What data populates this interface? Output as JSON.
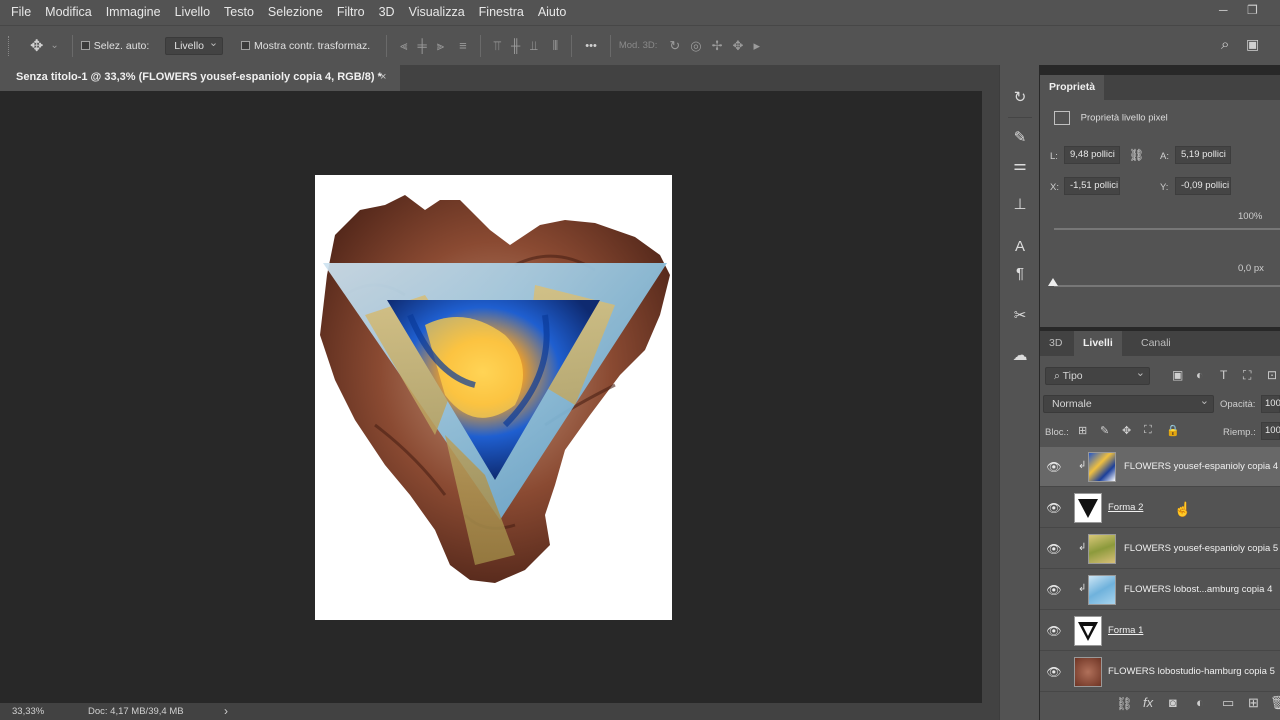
{
  "menu": [
    "File",
    "Modifica",
    "Immagine",
    "Livello",
    "Testo",
    "Selezione",
    "Filtro",
    "3D",
    "Visualizza",
    "Finestra",
    "Aiuto"
  ],
  "window_controls": {
    "minimize": "─",
    "restore": "❐"
  },
  "options": {
    "auto_select_label": "Selez. auto:",
    "auto_select_value": "Livello",
    "transform_label": "Mostra contr. trasformaz.",
    "mode3d_label": "Mod. 3D:",
    "more": "•••"
  },
  "document": {
    "tab_title": "Senza titolo-1 @ 33,3% (FLOWERS yousef-espanioly copia 4, RGB/8) *",
    "close": "×"
  },
  "status": {
    "zoom": "33,33%",
    "doc": "Doc: 4,17 MB/39,4 MB",
    "arrow": "›"
  },
  "toolstrip_icons": [
    "history-icon",
    "brush-preset-icon",
    "adjustments-icon",
    "clone-source-icon",
    "character-icon",
    "paragraph-icon",
    "tools-icon",
    "cloud-library-icon"
  ],
  "properties": {
    "tab": "Proprietà",
    "title": "Proprietà livello pixel",
    "w_label": "L:",
    "w_value": "9,48 pollici",
    "h_label": "A:",
    "h_value": "5,19 pollici",
    "x_label": "X:",
    "x_value": "-1,51 pollici",
    "y_label": "Y:",
    "y_value": "-0,09 pollici",
    "percent": "100%",
    "px": "0,0 px"
  },
  "layers_panel": {
    "tabs": [
      "3D",
      "Livelli",
      "Canali"
    ],
    "filter_label": "Tipo",
    "blend_mode": "Normale",
    "opacity_label": "Opacità:",
    "opacity_value": "100",
    "lock_label": "Bloc.:",
    "fill_label": "Riemp.:",
    "fill_value": "100",
    "layers": [
      {
        "name": "FLOWERS yousef-espanioly copia 4",
        "selected": true,
        "clipped": true,
        "shape": false
      },
      {
        "name": "Forma 2",
        "selected": false,
        "clipped": false,
        "shape": true
      },
      {
        "name": "FLOWERS yousef-espanioly copia 5",
        "selected": false,
        "clipped": true,
        "shape": false
      },
      {
        "name": "FLOWERS lobost...amburg copia 4",
        "selected": false,
        "clipped": true,
        "shape": false
      },
      {
        "name": "Forma 1",
        "selected": false,
        "clipped": false,
        "shape": true
      },
      {
        "name": "FLOWERS lobostudio-hamburg copia 5",
        "selected": false,
        "clipped": false,
        "shape": false
      }
    ]
  }
}
